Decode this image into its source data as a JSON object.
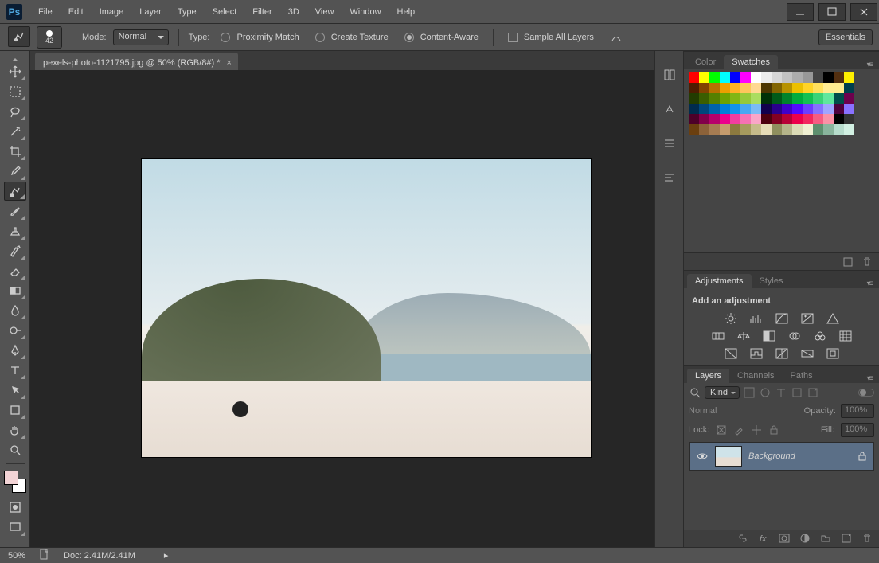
{
  "app": {
    "logo_text": "Ps"
  },
  "menu": [
    "File",
    "Edit",
    "Image",
    "Layer",
    "Type",
    "Select",
    "Filter",
    "3D",
    "View",
    "Window",
    "Help"
  ],
  "options": {
    "brush_size": "42",
    "mode_label": "Mode:",
    "mode_value": "Normal",
    "type_label": "Type:",
    "proximity": "Proximity Match",
    "texture": "Create Texture",
    "content_aware": "Content-Aware",
    "sample_all": "Sample All Layers",
    "workspace": "Essentials"
  },
  "document": {
    "tab_title": "pexels-photo-1121795.jpg @ 50% (RGB/8#) *"
  },
  "status": {
    "zoom": "50%",
    "doc_label": "Doc:",
    "doc_size": "2.41M/2.41M"
  },
  "panels": {
    "swatches": {
      "tab_color": "Color",
      "tab_swatches": "Swatches"
    },
    "adjustments": {
      "tab_adj": "Adjustments",
      "tab_styles": "Styles",
      "title": "Add an adjustment"
    },
    "layers": {
      "tab_layers": "Layers",
      "tab_channels": "Channels",
      "tab_paths": "Paths",
      "filter_kind": "Kind",
      "blend_mode": "Normal",
      "opacity_label": "Opacity:",
      "opacity_value": "100%",
      "lock_label": "Lock:",
      "fill_label": "Fill:",
      "fill_value": "100%",
      "bg_layer": "Background"
    }
  },
  "swatch_colors": [
    "#ff0000",
    "#ffff00",
    "#00ff00",
    "#00ffff",
    "#0000ff",
    "#ff00ff",
    "#ffffff",
    "#ebebeb",
    "#d6d6d6",
    "#c2c2c2",
    "#adadad",
    "#999999",
    "#444444",
    "#000000",
    "#532f10",
    "#ffef00",
    "#4d1d00",
    "#824300",
    "#b77100",
    "#ec9f00",
    "#ffb327",
    "#ffc65c",
    "#ffd991",
    "#4d3600",
    "#826400",
    "#b79200",
    "#ecc000",
    "#ffd427",
    "#ffe05c",
    "#ffec91",
    "#ffec91",
    "#003f4d",
    "#223c00",
    "#3b5e00",
    "#558000",
    "#6ea200",
    "#82b614",
    "#96c93a",
    "#aadd60",
    "#003107",
    "#005a19",
    "#00832b",
    "#00ac3d",
    "#14c051",
    "#3ad377",
    "#60e79d",
    "#004d4a",
    "#6d004d",
    "#002b4d",
    "#00477c",
    "#0063ab",
    "#007fda",
    "#1393ee",
    "#47a7f2",
    "#7bbbf6",
    "#12004d",
    "#29008c",
    "#4000cb",
    "#5209ff",
    "#6c3dff",
    "#8671ff",
    "#a0a5ff",
    "#4d003c",
    "#8971ff",
    "#4d0029",
    "#82004a",
    "#b7006b",
    "#ec008c",
    "#f23da0",
    "#f671b4",
    "#faa5c8",
    "#4d000e",
    "#820022",
    "#b70036",
    "#ec004a",
    "#f2275e",
    "#f65c82",
    "#fa91a6",
    "#000000",
    "#333333",
    "#6b3f0f",
    "#8c6239",
    "#a67c52",
    "#c69c6d",
    "#8c7a3f",
    "#a69b5e",
    "#c6bb8a",
    "#e6dcb7",
    "#8f8f5e",
    "#b5b58a",
    "#dcdcb7",
    "#f0f0d2",
    "#5e8f6e",
    "#8ab59d",
    "#b7dccc",
    "#d2f0e2"
  ]
}
